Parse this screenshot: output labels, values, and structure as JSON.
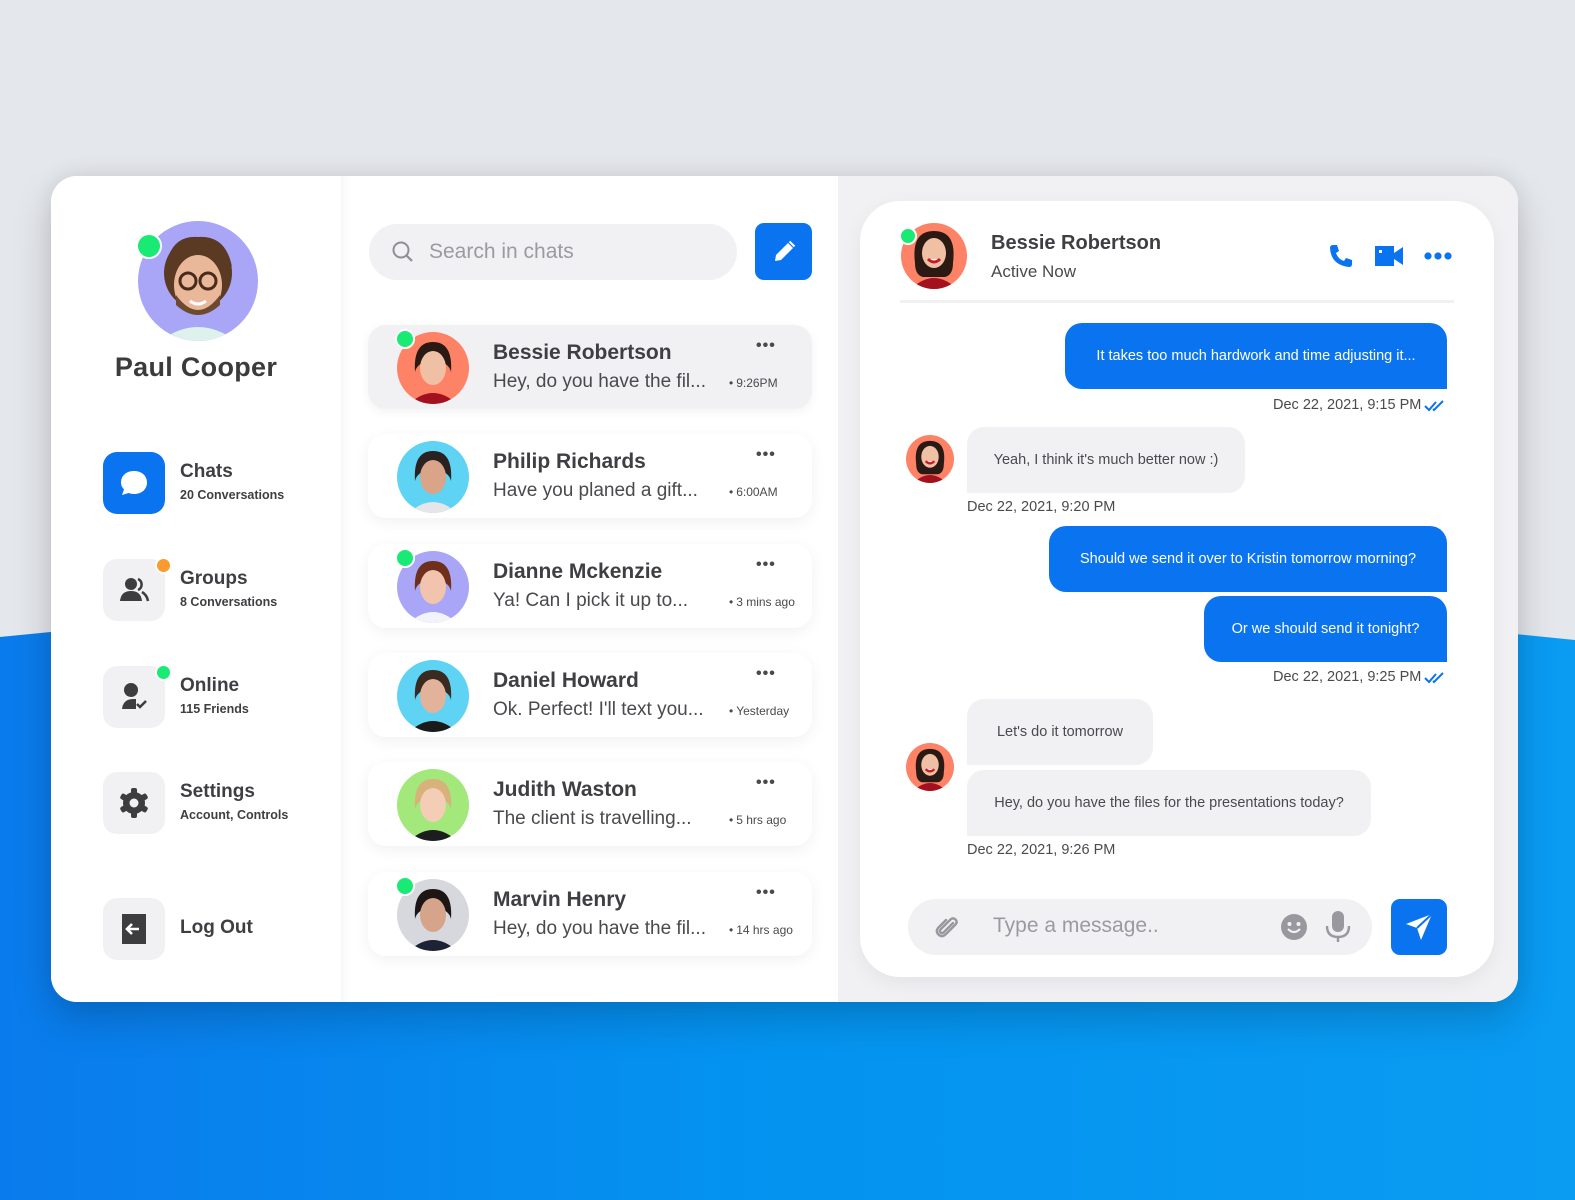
{
  "colors": {
    "accent": "#0a74f0",
    "online": "#18ea74",
    "badge_orange": "#fb9a2e",
    "surface": "#f1f1f4"
  },
  "profile": {
    "name": "Paul Cooper",
    "status": "online",
    "avatar_icon": "user-avatar"
  },
  "sidebar": {
    "items": [
      {
        "id": "chats",
        "title": "Chats",
        "subtitle": "20 Conversations",
        "icon": "chat-bubble-icon",
        "active": true
      },
      {
        "id": "groups",
        "title": "Groups",
        "subtitle": "8 Conversations",
        "icon": "group-icon",
        "badge": "orange"
      },
      {
        "id": "online",
        "title": "Online",
        "subtitle": "115 Friends",
        "icon": "user-check-icon",
        "badge": "green"
      },
      {
        "id": "settings",
        "title": "Settings",
        "subtitle": "Account, Controls",
        "icon": "gear-icon"
      }
    ],
    "logout": {
      "title": "Log Out",
      "icon": "logout-icon"
    }
  },
  "chat_list": {
    "search": {
      "placeholder": "Search in chats",
      "value": ""
    },
    "compose_icon": "pencil-icon",
    "items": [
      {
        "name": "Bessie Robertson",
        "preview": "Hey, do you have the fil...",
        "time": "9:26PM",
        "online": true,
        "selected": true,
        "avatar_bg": "#fd8266"
      },
      {
        "name": "Philip Richards",
        "preview": "Have you planed a gift...",
        "time": "6:00AM",
        "online": false,
        "avatar_bg": "#5ed3f3"
      },
      {
        "name": "Dianne Mckenzie",
        "preview": "Ya! Can I pick it up to...",
        "time": "3 mins ago",
        "online": true,
        "avatar_bg": "#a9a6f8"
      },
      {
        "name": "Daniel Howard",
        "preview": "Ok. Perfect! I'll text you...",
        "time": "Yesterday",
        "online": false,
        "avatar_bg": "#5ed3f3"
      },
      {
        "name": "Judith Waston",
        "preview": "The client is travelling...",
        "time": "5 hrs ago",
        "online": false,
        "avatar_bg": "#a2e87a"
      },
      {
        "name": "Marvin Henry",
        "preview": "Hey, do you have the fil...",
        "time": "14 hrs ago",
        "online": true,
        "avatar_bg": "#d6d8dd"
      }
    ]
  },
  "conversation": {
    "contact": {
      "name": "Bessie Robertson",
      "status": "Active Now",
      "online": true
    },
    "actions": [
      "phone-icon",
      "video-icon",
      "more-icon"
    ],
    "messages": [
      {
        "direction": "out",
        "text": "It takes too much hardwork and time adjusting it..."
      },
      {
        "direction": "meta-out",
        "text": "Dec 22, 2021, 9:15 PM",
        "read": true
      },
      {
        "direction": "in",
        "text": "Yeah, I think it's much better now :)"
      },
      {
        "direction": "meta-in",
        "text": "Dec 22, 2021, 9:20 PM"
      },
      {
        "direction": "out",
        "text": "Should we send it over to Kristin tomorrow morning?"
      },
      {
        "direction": "out",
        "text": "Or we should send it tonight?"
      },
      {
        "direction": "meta-out",
        "text": "Dec 22, 2021, 9:25 PM",
        "read": true
      },
      {
        "direction": "in",
        "text": "Let's do it tomorrow"
      },
      {
        "direction": "in",
        "text": "Hey, do you have the files for the presentations today?"
      },
      {
        "direction": "meta-in",
        "text": "Dec 22, 2021, 9:26 PM"
      }
    ],
    "composer": {
      "placeholder": "Type a message..",
      "value": ""
    }
  }
}
